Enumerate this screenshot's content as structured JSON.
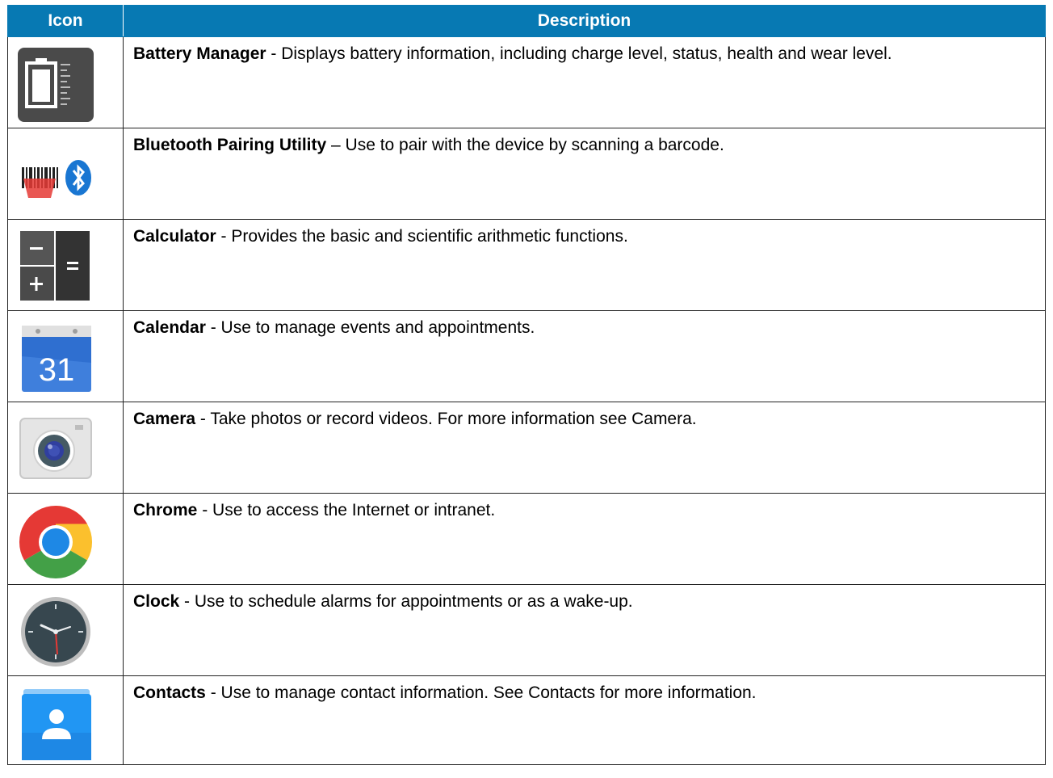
{
  "table": {
    "headers": {
      "icon": "Icon",
      "description": "Description"
    },
    "rows": [
      {
        "icon": "battery-manager-icon",
        "name": "Battery Manager",
        "separator": " - ",
        "text": "Displays battery information, including charge level, status, health and wear level."
      },
      {
        "icon": "bluetooth-pairing-icon",
        "name": "Bluetooth Pairing Utility",
        "separator": " – ",
        "text": "Use to pair with the device by scanning a barcode."
      },
      {
        "icon": "calculator-icon",
        "name": "Calculator",
        "separator": " - ",
        "text": "Provides the basic and scientific arithmetic functions."
      },
      {
        "icon": "calendar-icon",
        "name": "Calendar",
        "separator": " - ",
        "text": "Use to manage events and appointments.",
        "icon_text": "31"
      },
      {
        "icon": "camera-icon",
        "name": "Camera",
        "separator": " - ",
        "text": "Take photos or record videos. For more information see Camera."
      },
      {
        "icon": "chrome-icon",
        "name": "Chrome",
        "separator": " - ",
        "text": "Use to access the Internet or intranet."
      },
      {
        "icon": "clock-icon",
        "name": "Clock",
        "separator": " - ",
        "text": "Use to schedule alarms for appointments or as a wake-up."
      },
      {
        "icon": "contacts-icon",
        "name": "Contacts",
        "separator": " - ",
        "text": "Use to manage contact information. See Contacts for more information."
      }
    ]
  },
  "colors": {
    "header_bg": "#0779b3",
    "header_text": "#ffffff"
  }
}
